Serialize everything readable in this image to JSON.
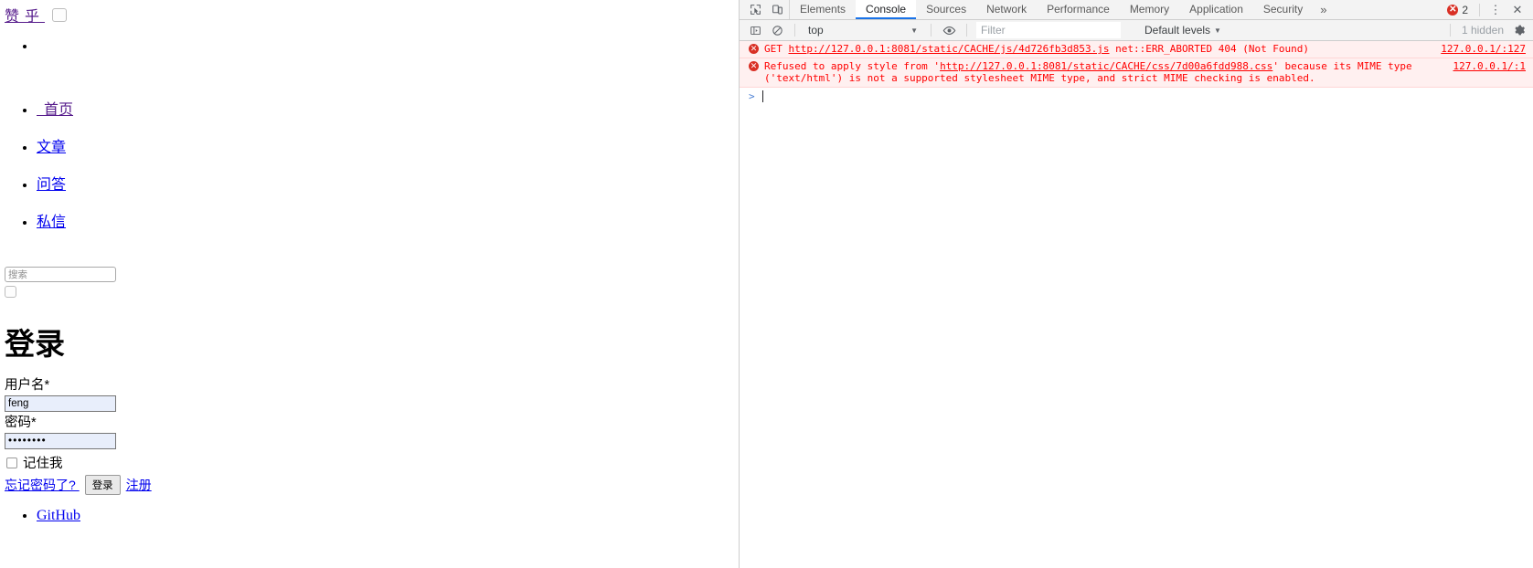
{
  "page": {
    "logo": "赞 乎 ",
    "logo_toggle_icon": "menu-toggle-icon",
    "nav": [
      {
        "label": "",
        "blank": true
      },
      {
        "label": "  首页",
        "visited": true
      },
      {
        "label": "文章",
        "visited": false
      },
      {
        "label": "问答",
        "visited": false
      },
      {
        "label": "私信",
        "visited": false
      }
    ],
    "search": {
      "placeholder": "搜索",
      "value": "",
      "button_label": ""
    },
    "title": "登录",
    "form": {
      "username_label": "用户名*",
      "username_value": "feng",
      "password_label": "密码*",
      "password_value": "••••••••",
      "remember_label": "记住我",
      "forgot_link": "忘记密码了? ",
      "submit_label": "登录",
      "register_link": "注册"
    },
    "footer_links": [
      {
        "label": "GitHub"
      }
    ]
  },
  "devtools": {
    "left_icons": [
      {
        "name": "inspect-element-icon"
      },
      {
        "name": "device-toolbar-icon"
      }
    ],
    "tabs": [
      {
        "label": "Elements",
        "active": false
      },
      {
        "label": "Console",
        "active": true
      },
      {
        "label": "Sources",
        "active": false
      },
      {
        "label": "Network",
        "active": false
      },
      {
        "label": "Performance",
        "active": false
      },
      {
        "label": "Memory",
        "active": false
      },
      {
        "label": "Application",
        "active": false
      },
      {
        "label": "Security",
        "active": false
      }
    ],
    "more_tabs_label": "»",
    "error_badge_count": "2",
    "kebab_label": "⋮",
    "close_label": "✕",
    "filterbar": {
      "clear_console_icon": "no-entry-icon",
      "sidebar_icon": "console-sidebar-icon",
      "context": "top",
      "context_caret": "▼",
      "eye_icon": "live-expression-eye-icon",
      "filter_placeholder": "Filter",
      "filter_value": "",
      "levels_label": "Default levels",
      "levels_caret": "▼",
      "hidden_label": "1 hidden",
      "settings_icon": "gear-icon"
    },
    "messages": [
      {
        "icon": "error-icon",
        "prefix": "GET ",
        "link": "http://127.0.0.1:8081/static/CACHE/js/4d726fb3d853.js",
        "suffix": " net::ERR_ABORTED 404 (Not Found)",
        "source": "127.0.0.1/:127"
      },
      {
        "icon": "error-icon",
        "prefix": "Refused to apply style from '",
        "link": "http://127.0.0.1:8081/static/CACHE/css/7d00a6fdd988.css",
        "suffix": "' because its MIME type ('text/html') is not a supported stylesheet MIME type, and strict MIME checking is enabled.",
        "source": "127.0.0.1/:1"
      }
    ],
    "prompt": {
      "arrow": ">",
      "value": ""
    }
  },
  "colors": {
    "error_red": "#ff0000",
    "error_bg": "#fff0f0",
    "accent_blue": "#1a73e8",
    "link_blue": "#0000ee",
    "visited_purple": "#551a8b",
    "badge_red": "#d93025"
  }
}
